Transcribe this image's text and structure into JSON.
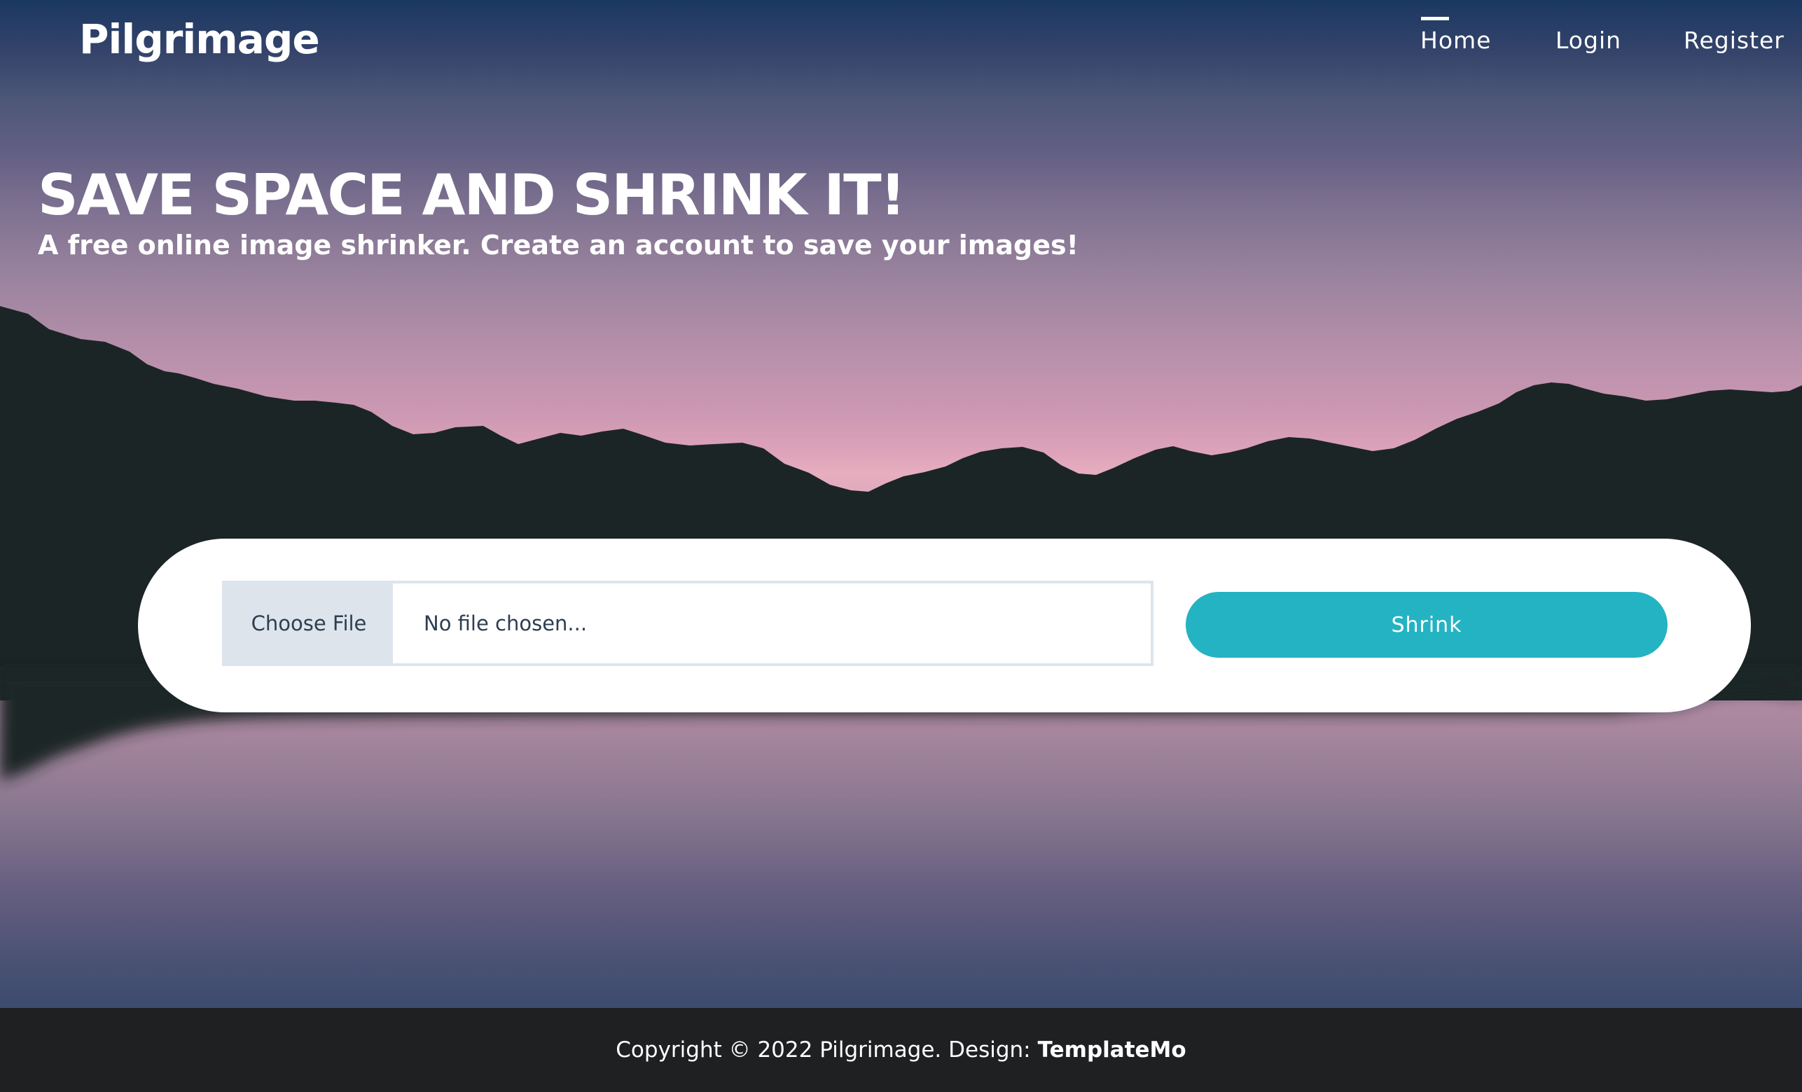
{
  "navbar": {
    "brand": "Pilgrimage",
    "items": [
      {
        "label": "Home",
        "active": true
      },
      {
        "label": "Login",
        "active": false
      },
      {
        "label": "Register",
        "active": false
      }
    ]
  },
  "hero": {
    "title": "SAVE SPACE AND SHRINK IT!",
    "subtitle": "A free online image shrinker. Create an account to save your images!"
  },
  "upload": {
    "choose_label": "Choose File",
    "status_text": "No file chosen...",
    "submit_label": "Shrink"
  },
  "footer": {
    "copyright": "Copyright © 2022 Pilgrimage. Design:",
    "designer": "TemplateMo"
  },
  "colors": {
    "accent": "#24b3c3",
    "footer_bg": "#1f2022",
    "mountain": "#1b2526",
    "sky_top": "#1a3862",
    "horizon_pink": "#e6aebf"
  }
}
